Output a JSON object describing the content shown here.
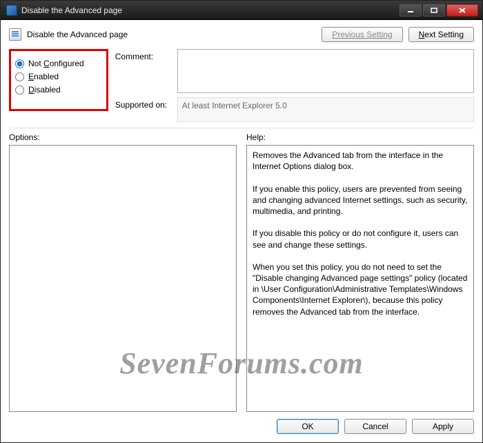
{
  "titlebar": {
    "title": "Disable the Advanced page"
  },
  "header": {
    "page_title": "Disable the Advanced page",
    "prev_label": "Previous Setting",
    "next_label": "Next Setting"
  },
  "state": {
    "options": [
      {
        "label_prefix": "N",
        "label_rest": "ot Configured",
        "value": "not_configured"
      },
      {
        "label_prefix": "E",
        "label_rest": "nabled",
        "value": "enabled"
      },
      {
        "label_prefix": "D",
        "label_rest": "isabled",
        "value": "disabled"
      }
    ],
    "selected": "not_configured"
  },
  "fields": {
    "comment_label": "Comment:",
    "comment_value": "",
    "supported_label": "Supported on:",
    "supported_value": "At least Internet Explorer 5.0"
  },
  "panes": {
    "options_label": "Options:",
    "options_text": "",
    "help_label": "Help:",
    "help_text": "Removes the Advanced tab from the interface in the Internet Options dialog box.\n\nIf you enable this policy, users are prevented from seeing and changing advanced Internet settings, such as security, multimedia, and printing.\n\nIf you disable this policy or do not configure it, users can see and change these settings.\n\nWhen you set this policy, you do not need to set the \"Disable changing Advanced page settings\" policy (located in \\User Configuration\\Administrative Templates\\Windows Components\\Internet Explorer\\), because this policy removes the Advanced tab from the interface."
  },
  "footer": {
    "ok": "OK",
    "cancel": "Cancel",
    "apply": "Apply"
  },
  "watermark": "SevenForums.com"
}
